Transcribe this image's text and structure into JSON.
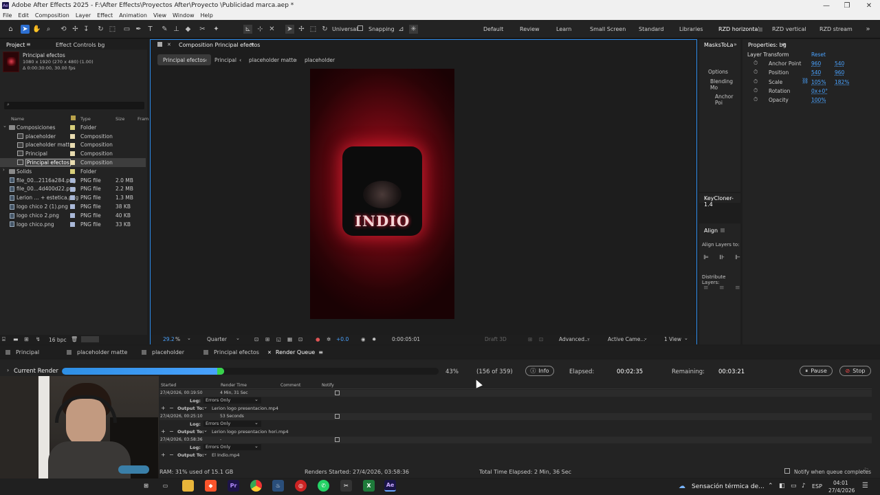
{
  "window": {
    "title": "Adobe After Effects 2025 - F:\\After Effects\\Proyectos After\\Proyecto \\Publicidad marca.aep *",
    "app_badge": "Ae"
  },
  "menu": [
    "File",
    "Edit",
    "Composition",
    "Layer",
    "Effect",
    "Animation",
    "View",
    "Window",
    "Help"
  ],
  "toolbar": {
    "universal": "Universal",
    "snapping": "Snapping",
    "workspaces": [
      "Default",
      "Review",
      "Learn",
      "Small Screen",
      "Standard",
      "Libraries",
      "RZD horizontal",
      "RZD vertical",
      "RZD stream"
    ],
    "active_workspace": "RZD horizontal"
  },
  "project": {
    "tab": "Project",
    "effect_controls_tab": "Effect Controls bg",
    "selected_name": "Principal efectos",
    "selected_info1": "1080 x 1920 (270 x 480) (1.00)",
    "selected_info2": "Δ 0:00:30:00, 30.00 fps",
    "search_placeholder": "",
    "columns": {
      "name": "Name",
      "type": "Type",
      "size": "Size",
      "frame": "Fram"
    },
    "items": [
      {
        "name": "Composiciones",
        "type": "Folder",
        "size": "",
        "color": "#d8cf7a",
        "kind": "folder",
        "indent": 0
      },
      {
        "name": "placeholder",
        "type": "Composition",
        "size": "",
        "color": "#e8dcb0",
        "kind": "comp",
        "indent": 1
      },
      {
        "name": "placeholder matte",
        "type": "Composition",
        "size": "",
        "color": "#e8dcb0",
        "kind": "comp",
        "indent": 1
      },
      {
        "name": "Principal",
        "type": "Composition",
        "size": "",
        "color": "#e8dcb0",
        "kind": "comp",
        "indent": 1
      },
      {
        "name": "Principal efectos",
        "type": "Composition",
        "size": "",
        "color": "#e8dcb0",
        "kind": "comp",
        "indent": 1,
        "selected": true
      },
      {
        "name": "Solids",
        "type": "Folder",
        "size": "",
        "color": "#d8cf7a",
        "kind": "folder",
        "indent": 0
      },
      {
        "name": "file_00...2116a284.png",
        "type": "PNG file",
        "size": "2.0 MB",
        "color": "#a9b8d8",
        "kind": "file",
        "indent": 0
      },
      {
        "name": "file_00...4d400d22.png",
        "type": "PNG file",
        "size": "2.2 MB",
        "color": "#a9b8d8",
        "kind": "file",
        "indent": 0
      },
      {
        "name": "Lerion ... + estetica.png",
        "type": "PNG file",
        "size": "1.3 MB",
        "color": "#a9b8d8",
        "kind": "file",
        "indent": 0
      },
      {
        "name": "logo chico 2 (1).png",
        "type": "PNG file",
        "size": "38 KB",
        "color": "#a9b8d8",
        "kind": "file",
        "indent": 0
      },
      {
        "name": "logo chico 2.png",
        "type": "PNG file",
        "size": "40 KB",
        "color": "#a9b8d8",
        "kind": "file",
        "indent": 0
      },
      {
        "name": "logo chico.png",
        "type": "PNG file",
        "size": "33 KB",
        "color": "#a9b8d8",
        "kind": "file",
        "indent": 0
      }
    ],
    "bpc": "16 bpc"
  },
  "composition": {
    "tab": "Composition Principal efectos",
    "breadcrumbs": [
      "Principal efectos",
      "Principal",
      "placeholder matte",
      "placeholder"
    ],
    "logo_text": "INDIO",
    "zoom": "29.2",
    "zoom_unit": "%",
    "resolution": "Quarter",
    "exposure": "+0.0",
    "timecode": "0:00:05:01",
    "draft3d": "Draft 3D",
    "renderer": "Advanced...",
    "camera": "Active Came...",
    "views": "1 View"
  },
  "side_panels": {
    "masks_tab": "MasksToLa",
    "options": "Options",
    "blending": "Blending Mo",
    "anchor": "Anchor Poi",
    "keycloner": "KeyCloner-1.4",
    "align_tab": "Align",
    "align_layers_to": "Align Layers to:",
    "distribute": "Distribute Layers:"
  },
  "properties": {
    "tab": "Properties: bg",
    "section": "Layer Transform",
    "reset": "Reset",
    "rows": [
      {
        "label": "Anchor Point",
        "v1": "960",
        "v2": "540"
      },
      {
        "label": "Position",
        "v1": "540",
        "v2": "960"
      },
      {
        "label": "Scale",
        "v1": "105%",
        "v2": "182%"
      },
      {
        "label": "Rotation",
        "v1": "0x+0°",
        "v2": ""
      },
      {
        "label": "Opacity",
        "v1": "100%",
        "v2": ""
      }
    ]
  },
  "timeline_tabs": [
    "Principal",
    "placeholder matte",
    "placeholder",
    "Principal efectos",
    "Render Queue"
  ],
  "render": {
    "current_render": "Current Render",
    "progress": 0.43,
    "percent": "43%",
    "frames": "(156 of 359)",
    "info": "Info",
    "elapsed_label": "Elapsed:",
    "elapsed": "00:02:35",
    "remaining_label": "Remaining:",
    "remaining": "00:03:21",
    "pause": "Pause",
    "stop": "Stop",
    "headers": {
      "started": "Started",
      "render_time": "Render Time",
      "comment": "Comment",
      "notify": "Notify"
    },
    "items": [
      {
        "started": "27/4/2026, 00:19:50",
        "render_time": "4 Min, 31 Sec",
        "log": "Errors Only",
        "output": "Lerion logo presentacion.mp4"
      },
      {
        "started": "27/4/2026, 00:25:10",
        "render_time": "53 Seconds",
        "log": "Errors Only",
        "output": "Lerion logo presentacion hori.mp4"
      },
      {
        "started": "27/4/2026, 03:58:36",
        "render_time": "-",
        "log": "Errors Only",
        "output": "El Indio.mp4"
      }
    ],
    "log_label": "Log:",
    "output_label": "Output To:",
    "ram": "RAM: 31% used of 15.1 GB",
    "renders_started": "Renders Started: 27/4/2026, 03:58:36",
    "total_elapsed": "Total Time Elapsed: 2 Min, 36 Sec",
    "notify_when": "Notify when queue completes"
  },
  "taskbar": {
    "weather": "Sensación térmica de...",
    "lang": "ESP",
    "time": "04:01",
    "date": "27/4/2026"
  }
}
